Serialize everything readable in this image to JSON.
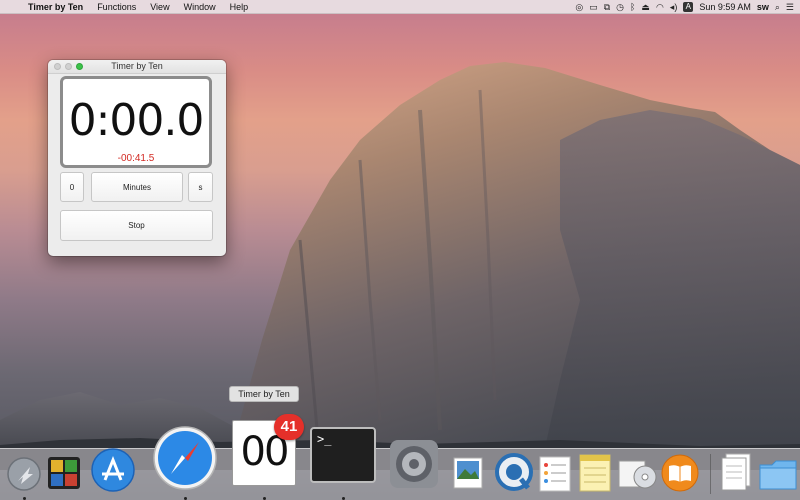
{
  "menubar": {
    "apple_glyph": "",
    "app_name": "Timer by Ten",
    "menus": [
      "Functions",
      "View",
      "Window",
      "Help"
    ],
    "status_icons": [
      "lastpass-icon",
      "airplay-icon",
      "display-icon",
      "time-machine-icon",
      "bluetooth-icon",
      "eject-icon",
      "wifi-icon",
      "volume-icon",
      "input-source-icon"
    ],
    "input_source_letter": "A",
    "clock": "Sun 9:59 AM",
    "user": "sw",
    "spotlight_icon": "search-icon",
    "notification_icon": "list-icon"
  },
  "window": {
    "title": "Timer by Ten",
    "time_display": "0:00.0",
    "elapsed": "-00:41.5",
    "buttons": {
      "zero": "0",
      "unit": "Minutes",
      "s": "s",
      "stop": "Stop"
    }
  },
  "tooltip": "Timer by Ten",
  "dock": {
    "items": [
      {
        "name": "launchpad-icon",
        "running": true
      },
      {
        "name": "activity-monitor-icon",
        "running": false
      },
      {
        "name": "app-store-icon",
        "running": false
      },
      {
        "name": "safari-icon",
        "running": true
      },
      {
        "name": "timer-by-ten-icon",
        "running": true
      },
      {
        "name": "terminal-icon",
        "running": true
      },
      {
        "name": "system-preferences-icon",
        "running": false
      },
      {
        "name": "preview-icon",
        "running": false
      },
      {
        "name": "quicktime-icon",
        "running": false
      },
      {
        "name": "reminders-icon",
        "running": false
      },
      {
        "name": "notes-icon",
        "running": false
      },
      {
        "name": "dvd-player-icon",
        "running": false
      },
      {
        "name": "ibooks-icon",
        "running": false
      },
      {
        "name": "html-document-icon",
        "running": false
      },
      {
        "name": "folder-icon",
        "running": false
      }
    ],
    "timer_tile_text": "00",
    "timer_badge": "41",
    "terminal_prompt": ">_"
  },
  "colors": {
    "elapsed_red": "#d32a23",
    "zoom_green": "#3bc24a",
    "badge_red": "#e5302a"
  }
}
